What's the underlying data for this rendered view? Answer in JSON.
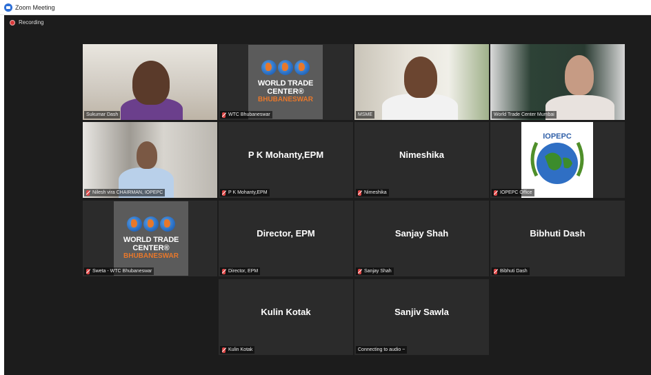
{
  "window": {
    "title": "Zoom Meeting"
  },
  "recording": {
    "label": "Recording"
  },
  "tiles": [
    {
      "label": "Sukumar Dash",
      "type": "video",
      "mic": false
    },
    {
      "label": "WTC Bhubaneswar",
      "type": "logo",
      "mic": true
    },
    {
      "label": "MSME",
      "type": "video",
      "mic": false
    },
    {
      "label": "World Trade Center Mumbai",
      "type": "video",
      "mic": false
    },
    {
      "label": "Nilesh vira CHAIRMAN, IOPEPC",
      "type": "video",
      "mic": true
    },
    {
      "label": "P K Mohanty,EPM",
      "center": "P K Mohanty,EPM",
      "type": "name",
      "mic": true
    },
    {
      "label": "Nimeshika",
      "center": "Nimeshika",
      "type": "name",
      "mic": true
    },
    {
      "label": "IOPEPC Office",
      "type": "logo",
      "mic": true
    },
    {
      "label": "Sweta - WTC Bhubaneswar",
      "type": "logo",
      "mic": true
    },
    {
      "label": "Director, EPM",
      "center": "Director, EPM",
      "type": "name",
      "mic": true
    },
    {
      "label": "Sanjay Shah",
      "center": "Sanjay Shah",
      "type": "name",
      "mic": true
    },
    {
      "label": "Bibhuti Dash",
      "center": "Bibhuti Dash",
      "type": "name",
      "mic": true
    },
    {
      "label": "Kulin Kotak",
      "center": "Kulin Kotak",
      "type": "name",
      "mic": true
    },
    {
      "label": "Connecting to audio ~",
      "center": "Sanjiv Sawla",
      "type": "name",
      "mic": false
    }
  ],
  "wtc_logo": {
    "line1": "WORLD TRADE",
    "line2": "CENTER®",
    "line3": "BHUBANESWAR"
  },
  "iopepc_logo": {
    "text": "IOPEPC"
  },
  "colors": {
    "background": "#1c1c1c",
    "tile": "#2b2b2b",
    "active_border": "#c9d94a",
    "muted_mic": "#e04848",
    "wtc_orange": "#e8782b"
  },
  "icons": {
    "app": "zoom-icon",
    "recording": "record-icon",
    "muted": "mic-muted-icon"
  }
}
